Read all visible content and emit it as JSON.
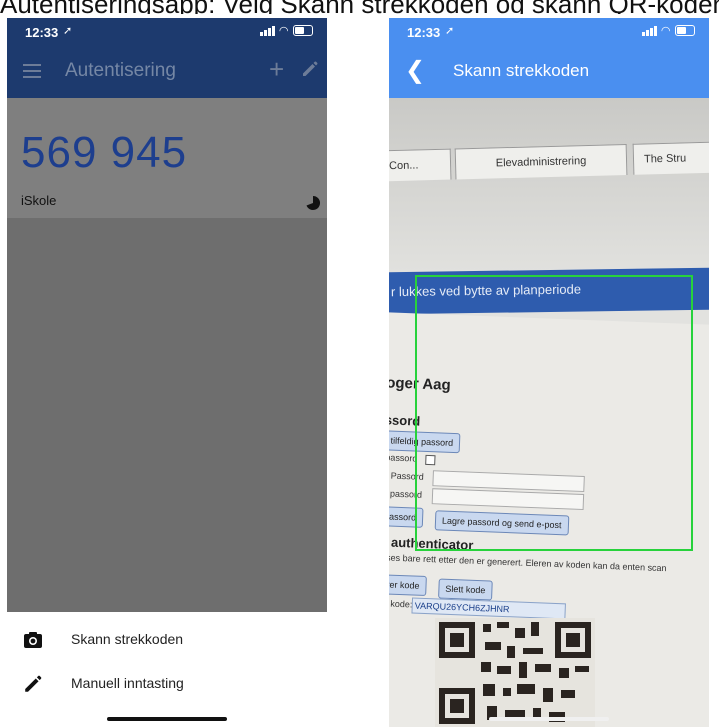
{
  "caption": {
    "text": "Autentiseringsapp: Velg Skann strekkoden og skann QR-koden fra iSkole"
  },
  "left_phone": {
    "status": {
      "time": "12:33",
      "location_icon": "location-arrow-icon"
    },
    "appbar": {
      "title": "Autentisering",
      "menu_icon": "hamburger-icon",
      "add_icon": "plus-icon",
      "edit_icon": "pencil-icon"
    },
    "account": {
      "code": "569 945",
      "name": "iSkole",
      "timer_icon": "countdown-pie-icon"
    },
    "sheet": {
      "items": [
        {
          "label": "Skann strekkoden",
          "icon": "camera-icon"
        },
        {
          "label": "Manuell inntasting",
          "icon": "pencil-icon"
        }
      ]
    }
  },
  "right_phone": {
    "status": {
      "time": "12:33"
    },
    "appbar": {
      "title": "Skann strekkoden",
      "back_icon": "chevron-left-icon"
    },
    "camera_view": {
      "tabs": [
        "ff Con...",
        "Elevadministrering",
        "The Stru"
      ],
      "banner": "r lukkes ved bytte av planperiode",
      "heading": "oger Aag",
      "section_password": "ssord",
      "btn_random": "r tilfeldig passord",
      "lbl_password_chk": "passord",
      "lbl_password": "Passord",
      "lbl_password2": "passord",
      "btn_save_pw": "passord",
      "btn_save_send": "Lagre passord og send e-post",
      "section_auth": "e authenticator",
      "note": "vises bare rett etter den er generert. Eleren av koden kan da enten scan",
      "btn_generate": "erer kode",
      "btn_delete": "Slett kode",
      "lbl_key": "gle kode:",
      "key_value": "VARQU26YCH6ZJHNR"
    },
    "scan_frame_color": "#27d23b"
  },
  "colors": {
    "left_bar": "#1d3a6e",
    "right_bar": "#4a8ff0",
    "code_blue": "#1d3e8e"
  }
}
